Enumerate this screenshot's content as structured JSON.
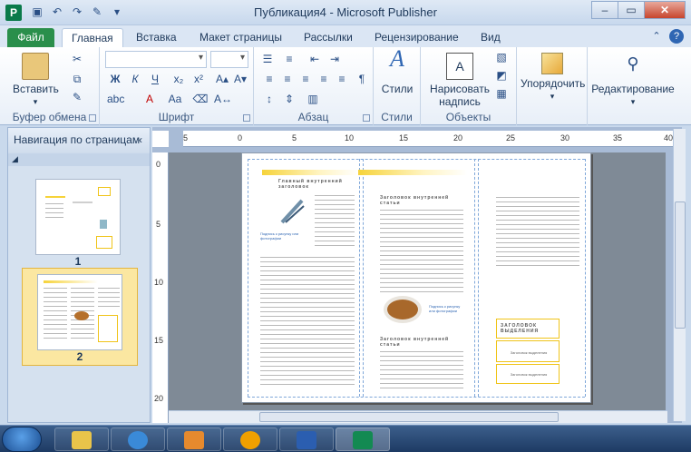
{
  "title": {
    "text": "Публикация4  -  Microsoft Publisher"
  },
  "window_buttons": {
    "minimize": "–",
    "maximize": "▭",
    "close": "✕"
  },
  "tabs": {
    "file": "Файл",
    "home": "Главная",
    "insert": "Вставка",
    "page_layout": "Макет страницы",
    "mailings": "Рассылки",
    "review": "Рецензирование",
    "view": "Вид"
  },
  "ribbon": {
    "clipboard": {
      "label": "Буфер обмена",
      "paste": "Вставить"
    },
    "font": {
      "label": "Шрифт"
    },
    "paragraph": {
      "label": "Абзац"
    },
    "styles": {
      "label": "Стили",
      "styles_btn": "Стили"
    },
    "objects": {
      "label": "Объекты",
      "draw_text_box": "Нарисовать надпись"
    },
    "arrange": {
      "label": "Упорядочить"
    },
    "editing": {
      "label": "Редактирование"
    }
  },
  "nav": {
    "title": "Навигация по страницам",
    "pages": [
      {
        "number": "1"
      },
      {
        "number": "2"
      }
    ]
  },
  "ruler": {
    "h_ticks": [
      "5",
      "0",
      "5",
      "10",
      "15",
      "20",
      "25",
      "30",
      "35",
      "40"
    ],
    "v_ticks": [
      "0",
      "5",
      "10",
      "15",
      "20"
    ]
  },
  "document": {
    "col1_heading": "Главный внутренний заголовок",
    "col2_heading1": "Заголовок внутренней статьи",
    "col2_heading2": "Заголовок внутренней статьи",
    "caption1": "Подпись к рисунку или фотографии",
    "caption2": "Подпись к рисунку или фотографии",
    "box_top": "ЗАГОЛОВОК ВЫДЕЛЕНИЯ",
    "box_mid": "Заголовок выделения",
    "box_bottom": "Заголовок выделения"
  },
  "colors": {
    "accent": "#f6d33a",
    "file_tab": "#2a8f4b",
    "selection": "#fbe7a1"
  }
}
